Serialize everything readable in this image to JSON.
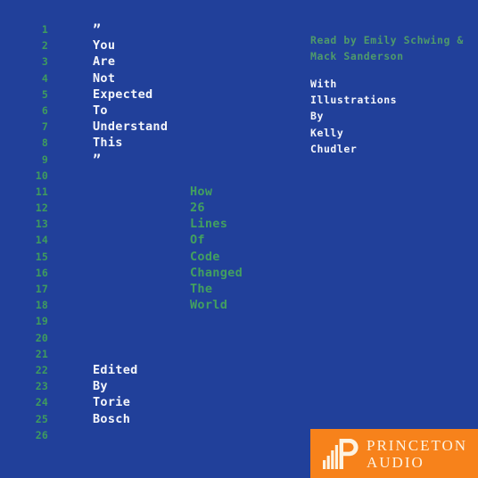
{
  "cover": {
    "background_color": "#21409a",
    "line_number_color": "#3f9b5e",
    "title_color": "#f4f6fb",
    "subtitle_color": "#43a05f",
    "narrator_color": "#4f9a6b",
    "logo_background_color": "#f7821b",
    "logo_text_color": "#fdf3e2"
  },
  "gutter": {
    "numbers": [
      "1",
      "2",
      "3",
      "4",
      "5",
      "6",
      "7",
      "8",
      "9",
      "10",
      "11",
      "12",
      "13",
      "14",
      "15",
      "16",
      "17",
      "18",
      "19",
      "20",
      "21",
      "22",
      "23",
      "24",
      "25",
      "26"
    ]
  },
  "title": {
    "lines": [
      "”",
      "You",
      "Are",
      "Not",
      "Expected",
      "To",
      "Understand",
      "This",
      "”"
    ]
  },
  "subtitle": {
    "lines": [
      "How",
      "26",
      "Lines",
      "Of",
      "Code",
      "Changed",
      "The",
      "World"
    ]
  },
  "editor": {
    "lines": [
      "Edited",
      "By",
      "Torie",
      "Bosch"
    ]
  },
  "narrator": {
    "lines": [
      "Read by Emily Schwing &",
      "Mack Sanderson"
    ]
  },
  "illustrator": {
    "lines": [
      "With",
      "Illustrations",
      "By",
      "Kelly",
      "Chudler"
    ]
  },
  "logo": {
    "mark_name": "princeton-audio-equalizer-p-mark",
    "line1": "PRINCETON",
    "line2": "AUDIO"
  }
}
